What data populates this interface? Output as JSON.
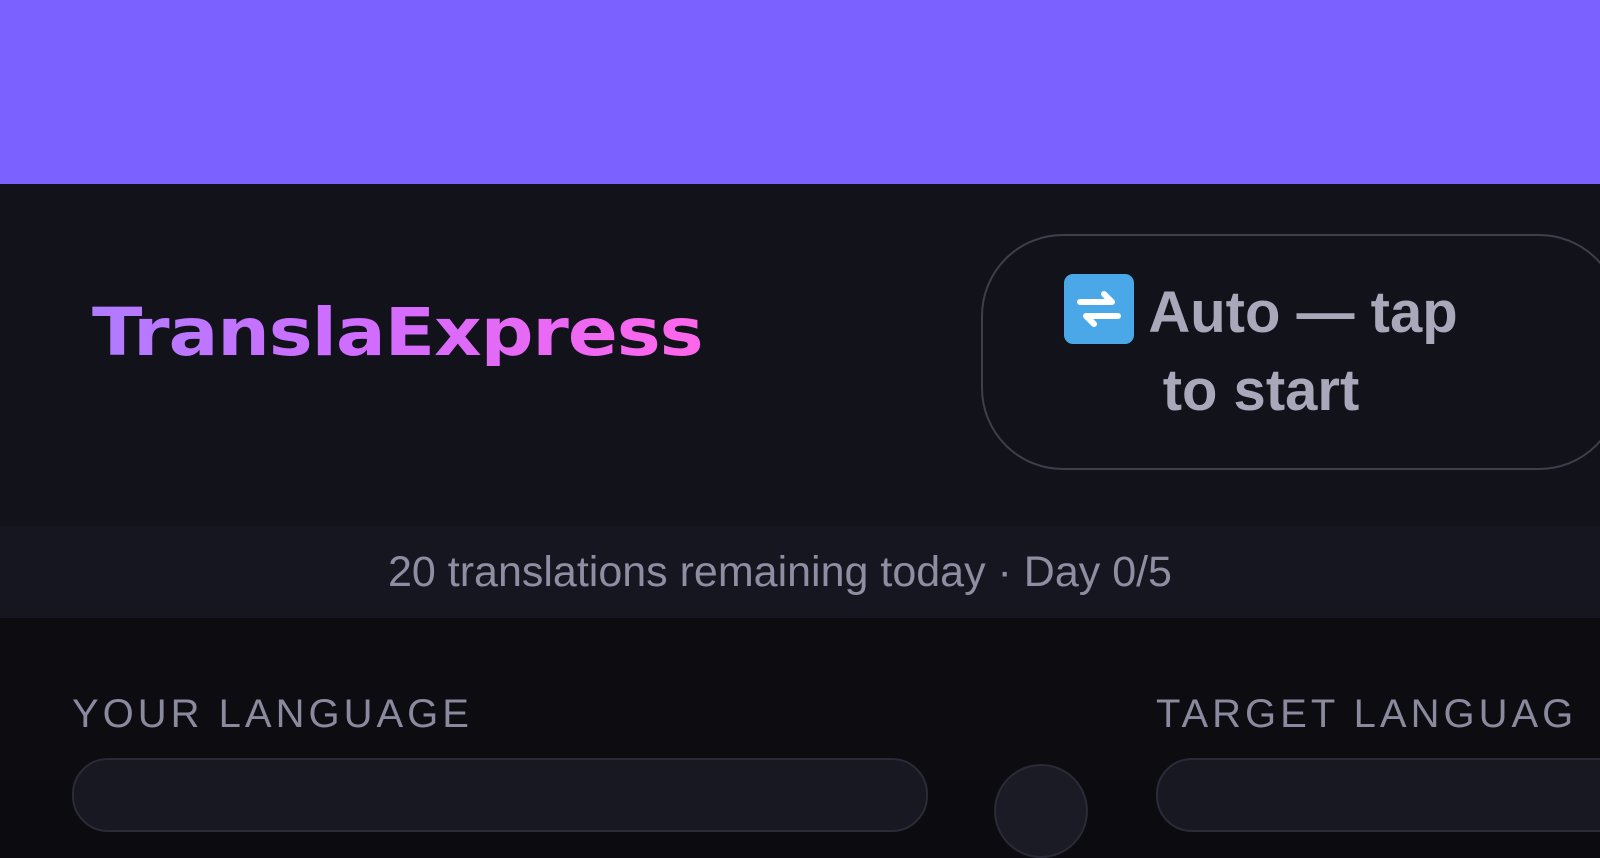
{
  "app": {
    "logo_text": "TranslaExpress",
    "brand_color": "#7b61ff",
    "logo_gradient": [
      "#b07cff",
      "#ff66ea"
    ]
  },
  "auto_mode": {
    "icon": "swap-arrows-icon",
    "label": "Auto — tap to start"
  },
  "status": {
    "text": "20 translations remaining today · Day 0/5"
  },
  "languages": {
    "your_label": "YOUR LANGUAGE",
    "target_label": "TARGET LANGUAG"
  }
}
